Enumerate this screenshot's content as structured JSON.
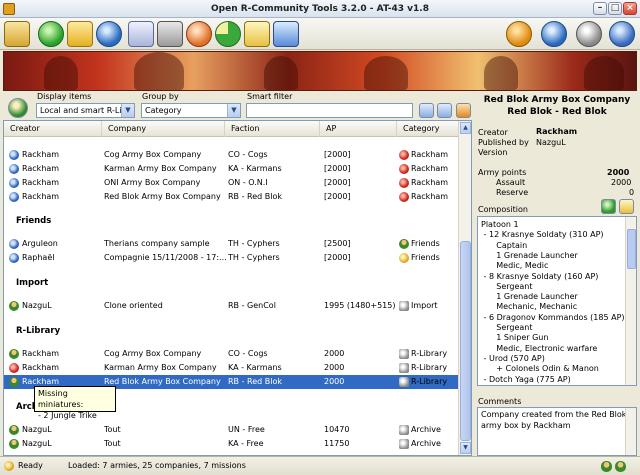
{
  "window": {
    "title": "Open R-Community Tools 3.2.0 - AT-43 v1.8"
  },
  "filters": {
    "display_label": "Display items",
    "display_value": "Local and smart R-Libra",
    "group_label": "Group by",
    "group_value": "Category",
    "smart_label": "Smart filter",
    "smart_value": ""
  },
  "columns": [
    "Creator",
    "Company",
    "Faction",
    "AP",
    "Category"
  ],
  "groups": [
    {
      "name": "",
      "rows": [
        {
          "creator": "Rackham",
          "company": "Cog Army Box Company",
          "faction": "CO - Cogs",
          "ap": "[2000]",
          "category": "Rackham"
        },
        {
          "creator": "Rackham",
          "company": "Karman Army Box Company",
          "faction": "KA - Karmans",
          "ap": "[2000]",
          "category": "Rackham"
        },
        {
          "creator": "Rackham",
          "company": "ONI Army Box Company",
          "faction": "ON - O.N.I",
          "ap": "[2000]",
          "category": "Rackham"
        },
        {
          "creator": "Rackham",
          "company": "Red Blok Army Box Company",
          "faction": "RB - Red Blok",
          "ap": "[2000]",
          "category": "Rackham"
        }
      ]
    },
    {
      "name": "Friends",
      "rows": [
        {
          "creator": "Arguleon",
          "company": "Therians company sample",
          "faction": "TH - Cyphers",
          "ap": "[2500]",
          "category": "Friends"
        },
        {
          "creator": "Raphaël",
          "company": "Compagnie 15/11/2008 - 17:...",
          "faction": "TH - Cyphers",
          "ap": "[2000]",
          "category": "Friends"
        }
      ]
    },
    {
      "name": "Import",
      "rows": [
        {
          "creator": "NazguL",
          "company": "Clone oriented",
          "faction": "RB - GenCol",
          "ap": "1995 (1480+515)",
          "category": "Import"
        }
      ]
    },
    {
      "name": "R-Library",
      "rows": [
        {
          "creator": "Rackham",
          "company": "Cog Army Box Company",
          "faction": "CO - Cogs",
          "ap": "2000",
          "category": "R-Library"
        },
        {
          "creator": "Rackham",
          "company": "Karman Army Box Company",
          "faction": "KA - Karmans",
          "ap": "2000",
          "category": "R-Library"
        },
        {
          "creator": "Rackham",
          "company": "Red Blok Army Box Company",
          "faction": "RB - Red Blok",
          "ap": "2000",
          "category": "R-Library"
        }
      ]
    },
    {
      "name": "Archi",
      "rows": [
        {
          "creator": "NazguL",
          "company": "Tout",
          "faction": "UN - Free",
          "ap": "10470",
          "category": "Archive"
        },
        {
          "creator": "NazguL",
          "company": "Tout",
          "faction": "KA - Free",
          "ap": "11750",
          "category": "Archive"
        }
      ]
    }
  ],
  "tooltip": {
    "line1": "Missing miniatures:",
    "line2": "- 2 Jungle Trike"
  },
  "details": {
    "title1": "Red Blok Army Box Company",
    "title2": "Red Blok - Red Blok",
    "creator_label": "Creator",
    "creator_value": "Rackham",
    "published_label": "Published by",
    "published_value": "NazguL",
    "version_label": "Version",
    "army_points_label": "Army points",
    "army_points_value": "2000",
    "assault_label": "Assault",
    "assault_value": "2000",
    "reserve_label": "Reserve",
    "reserve_value": "0",
    "composition_label": "Composition",
    "composition": [
      "Platoon 1",
      " - 12 Krasnye Soldaty (310 AP)",
      "      Captain",
      "      1 Grenade Launcher",
      "      Medic, Medic",
      " - 8 Krasnye Soldaty (160 AP)",
      "      Sergeant",
      "      1 Grenade Launcher",
      "      Mechanic, Mechanic",
      " - 6 Dragonov Kommandos (185 AP)",
      "      Sergeant",
      "      1 Sniper Gun",
      "      Medic, Electronic warfare",
      " - Urod (570 AP)",
      "      + Colonels Odin & Manon",
      " - Dotch Yaga (775 AP)"
    ],
    "comments_label": "Comments",
    "comments": [
      "Company created from the Red Blok",
      "army box by Rackham"
    ]
  },
  "status": {
    "ready": "Ready",
    "loaded": "Loaded: 7 armies, 25 companies, 7 missions"
  }
}
